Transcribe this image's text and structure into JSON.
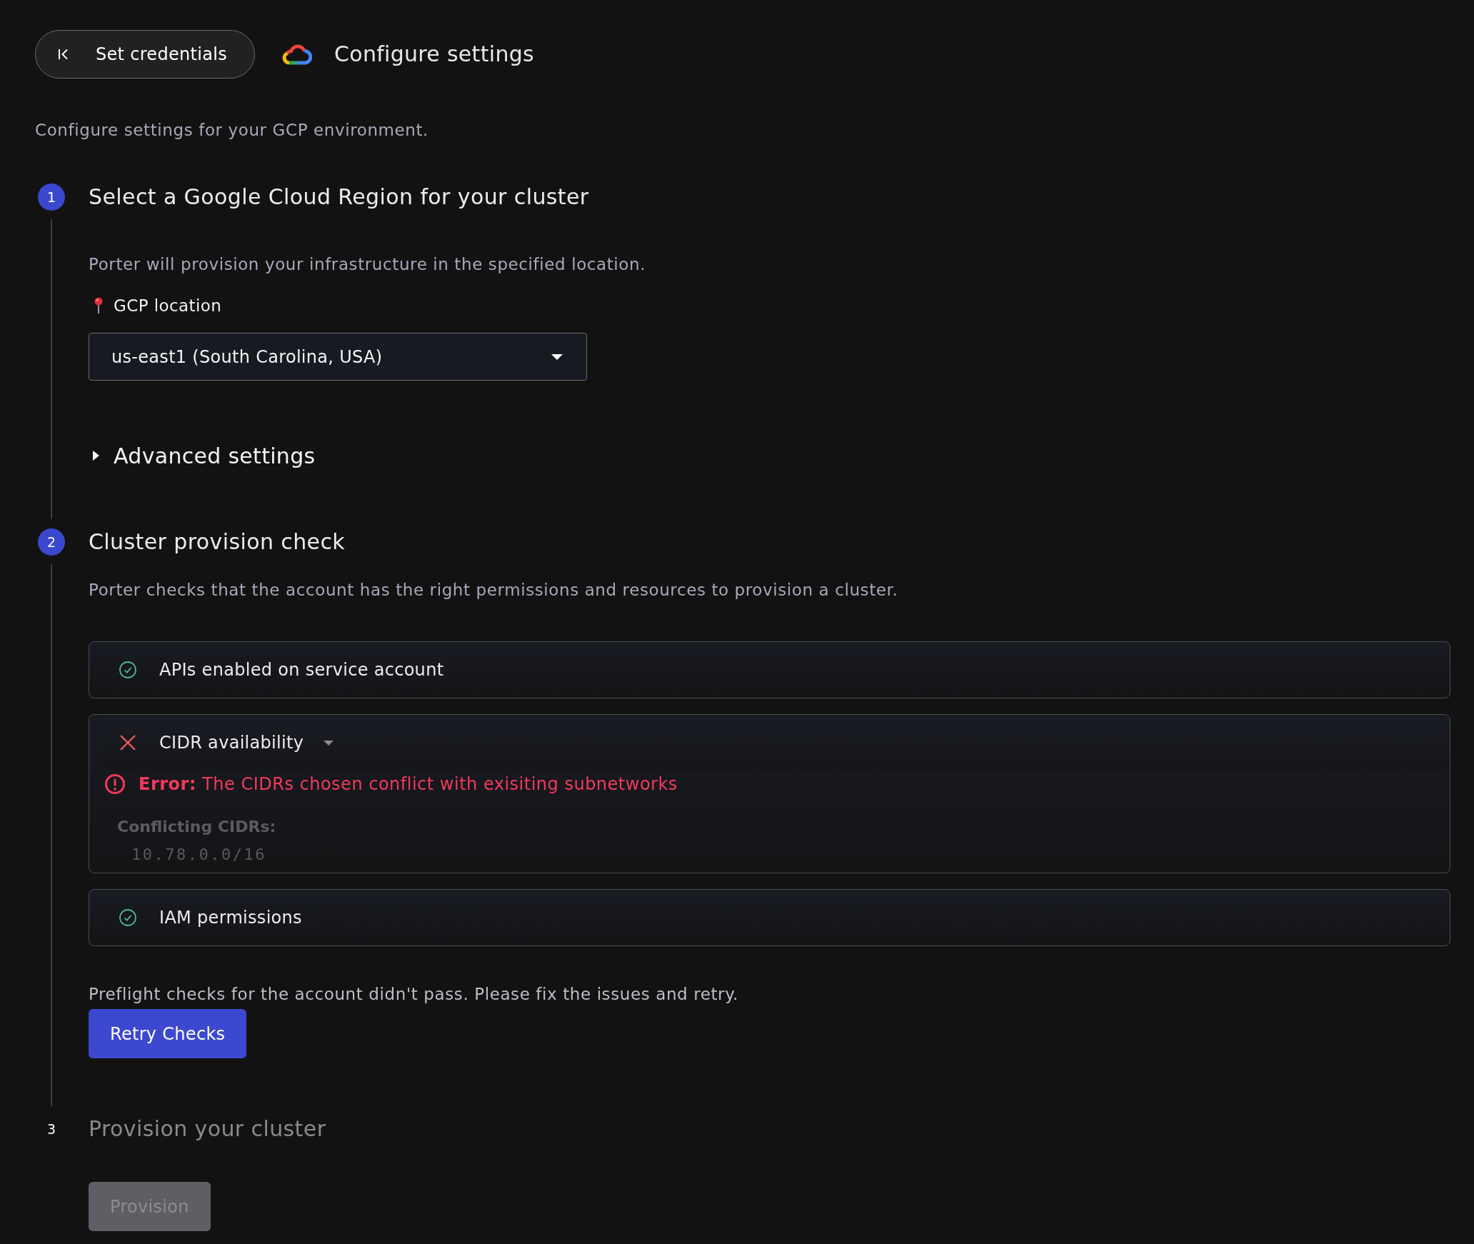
{
  "back_button": {
    "label": "Set credentials"
  },
  "title": "Configure settings",
  "description": "Configure settings for your GCP environment.",
  "steps": [
    {
      "kind": "region",
      "number": "1",
      "title": "Select a Google Cloud Region for your cluster",
      "disabled": false,
      "text": "Porter will provision your infrastructure in the specified location.",
      "location_label": "GCP location",
      "location": {
        "value": "us-east1 (South Carolina, USA)"
      },
      "advanced": {
        "label": "Advanced settings",
        "expanded": false
      }
    },
    {
      "kind": "checks",
      "number": "2",
      "title": "Cluster provision check",
      "disabled": false,
      "text": "Porter checks that the account has the right permissions and resources to provision a cluster.",
      "checks": [
        {
          "label": "APIs enabled on service account",
          "passed": true
        },
        {
          "label": "CIDR availability",
          "passed": false,
          "error": "**Error:** The CIDRs chosen conflict with exisiting subnetworks",
          "details_label": "Conflicting CIDRs:",
          "details": [
            "10.78.0.0/16"
          ]
        },
        {
          "label": "IAM permissions",
          "passed": true
        }
      ],
      "message": "Preflight checks for the account didn't pass. Please fix the issues and retry.",
      "button": {
        "label": "Retry Checks",
        "disabled": false
      }
    },
    {
      "kind": "provision",
      "number": "3",
      "title": "Provision your cluster",
      "disabled": true,
      "button": {
        "label": "Provision",
        "disabled": true
      }
    }
  ]
}
